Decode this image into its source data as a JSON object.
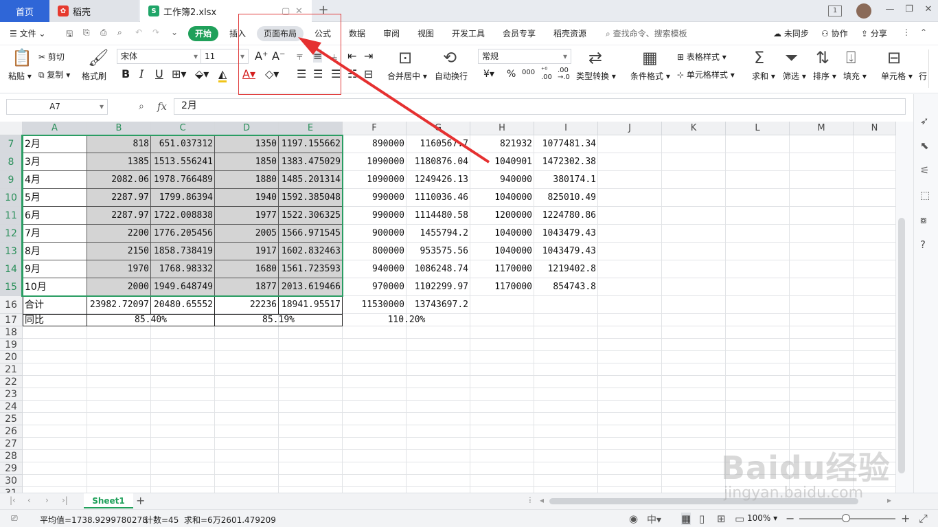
{
  "tabs": {
    "home": "首页",
    "daoke": "稻壳",
    "doc": "工作簿2.xlsx",
    "new_tab": "+"
  },
  "menu": {
    "file": "文件",
    "items": [
      "开始",
      "插入",
      "页面布局",
      "公式",
      "数据",
      "审阅",
      "视图",
      "开发工具",
      "会员专享",
      "稻壳资源"
    ],
    "search": "查找命令、搜索模板",
    "sync": "未同步",
    "collab": "协作",
    "share": "分享"
  },
  "ribbon": {
    "paste": "粘贴",
    "cut": "剪切",
    "copy": "复制",
    "format_painter": "格式刷",
    "font": "宋体",
    "font_size": "11",
    "merge": "合并居中",
    "wrap": "自动换行",
    "number_format": "常规",
    "type_convert": "类型转换",
    "cond_format": "条件格式",
    "table_style": "表格样式",
    "cell_style": "单元格样式",
    "sum": "求和",
    "filter": "筛选",
    "sort": "排序",
    "fill": "填充",
    "cell": "单元格",
    "row": "行"
  },
  "formula": {
    "name_box": "A7",
    "fx": "fx",
    "value": "2月"
  },
  "columns": [
    "A",
    "B",
    "C",
    "D",
    "E",
    "F",
    "G",
    "H",
    "I",
    "J",
    "K",
    "L",
    "M",
    "N"
  ],
  "rows": [
    {
      "n": "7",
      "c": [
        "2月",
        "818",
        "651.037312",
        "1350",
        "1197.155662",
        "890000",
        "1160567.7",
        "821932",
        "1077481.34"
      ]
    },
    {
      "n": "8",
      "c": [
        "3月",
        "1385",
        "1513.556241",
        "1850",
        "1383.475029",
        "1090000",
        "1180876.04",
        "1040901",
        "1472302.38"
      ]
    },
    {
      "n": "9",
      "c": [
        "4月",
        "2082.06",
        "1978.766489",
        "1880",
        "1485.201314",
        "1090000",
        "1249426.13",
        "940000",
        "380174.1"
      ]
    },
    {
      "n": "10",
      "c": [
        "5月",
        "2287.97",
        "1799.86394",
        "1940",
        "1592.385048",
        "990000",
        "1110036.46",
        "1040000",
        "825010.49"
      ]
    },
    {
      "n": "11",
      "c": [
        "6月",
        "2287.97",
        "1722.008838",
        "1977",
        "1522.306325",
        "990000",
        "1114480.58",
        "1200000",
        "1224780.86"
      ]
    },
    {
      "n": "12",
      "c": [
        "7月",
        "2200",
        "1776.205456",
        "2005",
        "1566.971545",
        "900000",
        "1455794.2",
        "1040000",
        "1043479.43"
      ]
    },
    {
      "n": "13",
      "c": [
        "8月",
        "2150",
        "1858.738419",
        "1917",
        "1602.832463",
        "800000",
        "953575.56",
        "1040000",
        "1043479.43"
      ]
    },
    {
      "n": "14",
      "c": [
        "9月",
        "1970",
        "1768.98332",
        "1680",
        "1561.723593",
        "940000",
        "1086248.74",
        "1170000",
        "1219402.8"
      ]
    },
    {
      "n": "15",
      "c": [
        "10月",
        "2000",
        "1949.648749",
        "1877",
        "2013.619466",
        "970000",
        "1102299.97",
        "1170000",
        "854743.8"
      ]
    },
    {
      "n": "16",
      "c": [
        "合计",
        "23982.72097",
        "20480.65552",
        "22236",
        "18941.95517",
        "11530000",
        "13743697.2",
        "",
        ""
      ]
    }
  ],
  "row17": {
    "n": "17",
    "label": "同比",
    "v1": "85.40%",
    "v2": "85.19%",
    "v3": "110.20%"
  },
  "empty_rows": [
    "18",
    "19",
    "20",
    "21",
    "22",
    "23",
    "24",
    "25",
    "26",
    "27",
    "28",
    "29",
    "30",
    "31"
  ],
  "sheet": {
    "name": "Sheet1",
    "add": "+"
  },
  "status": {
    "avg": "平均值=1738.9299780278",
    "count": "计数=45",
    "sum": "求和=6万2601.479209",
    "zoom": "100%"
  },
  "watermark": {
    "line1": "Baidu经验",
    "line2": "jingyan.baidu.com"
  }
}
